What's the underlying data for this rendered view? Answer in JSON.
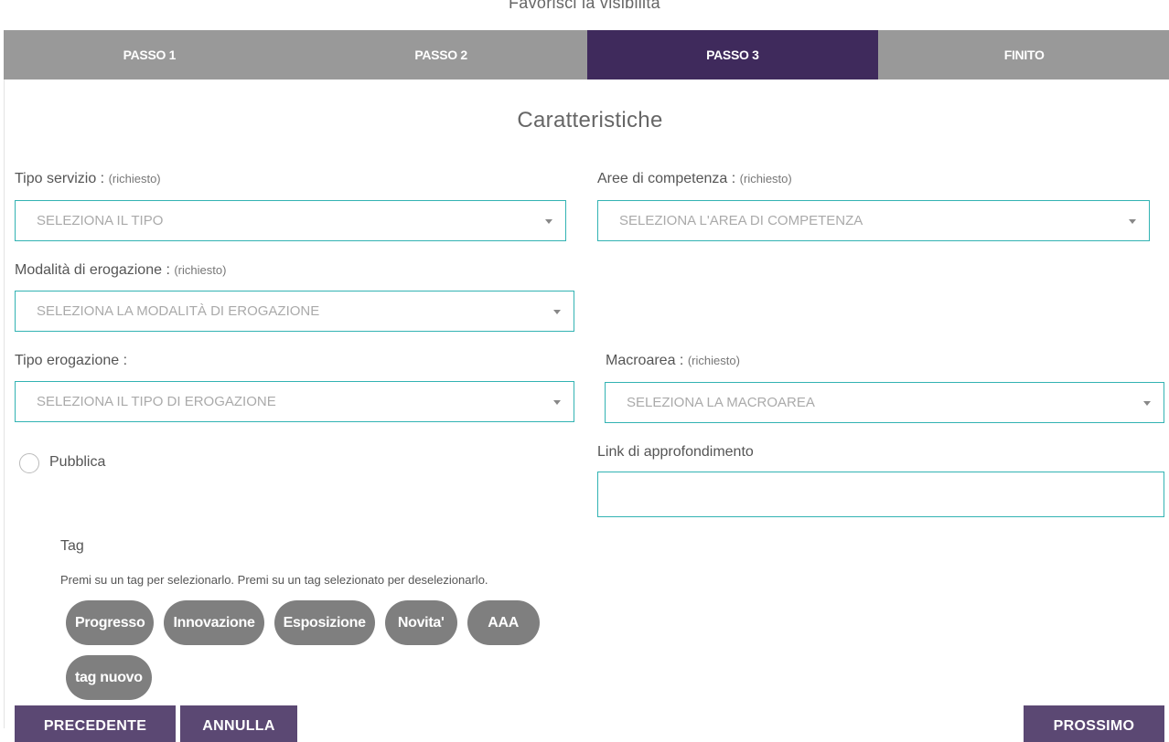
{
  "page": {
    "heading": "Favorisci la visibilità"
  },
  "steps": [
    {
      "label": "PASSO 1",
      "active": false
    },
    {
      "label": "PASSO 2",
      "active": false
    },
    {
      "label": "PASSO 3",
      "active": true
    },
    {
      "label": "FINITO",
      "active": false
    }
  ],
  "section": {
    "title": "Caratteristiche"
  },
  "form": {
    "required_note": "(richiesto)",
    "tipo_servizio": {
      "label": "Tipo servizio :",
      "placeholder": "SELEZIONA IL TIPO"
    },
    "aree_competenza": {
      "label": "Aree di competenza :",
      "placeholder": "SELEZIONA L'AREA DI COMPETENZA"
    },
    "modalita_erogazione": {
      "label": "Modalità di erogazione :",
      "placeholder": "SELEZIONA LA MODALITÀ DI EROGAZIONE"
    },
    "tipo_erogazione": {
      "label": "Tipo erogazione :",
      "placeholder": "SELEZIONA IL TIPO DI EROGAZIONE"
    },
    "macroarea": {
      "label": "Macroarea :",
      "placeholder": "SELEZIONA LA MACROAREA"
    },
    "pubblica": {
      "label": "Pubblica"
    },
    "link": {
      "label": "Link di approfondimento",
      "value": ""
    }
  },
  "tags": {
    "title": "Tag",
    "help": "Premi su un tag per selezionarlo. Premi su un tag selezionato per deselezionarlo.",
    "items": [
      "Progresso",
      "Innovazione",
      "Esposizione",
      "Novita'",
      "AAA",
      "tag nuovo"
    ]
  },
  "actions": {
    "previous": "PRECEDENTE",
    "cancel": "ANNULLA",
    "next": "PROSSIMO"
  },
  "colors": {
    "step_active": "#3f2a5c",
    "step_inactive": "#999999",
    "accent_border": "#32b3b3",
    "tag_bg": "#7f7f7f",
    "button_bg": "#5b4873"
  }
}
